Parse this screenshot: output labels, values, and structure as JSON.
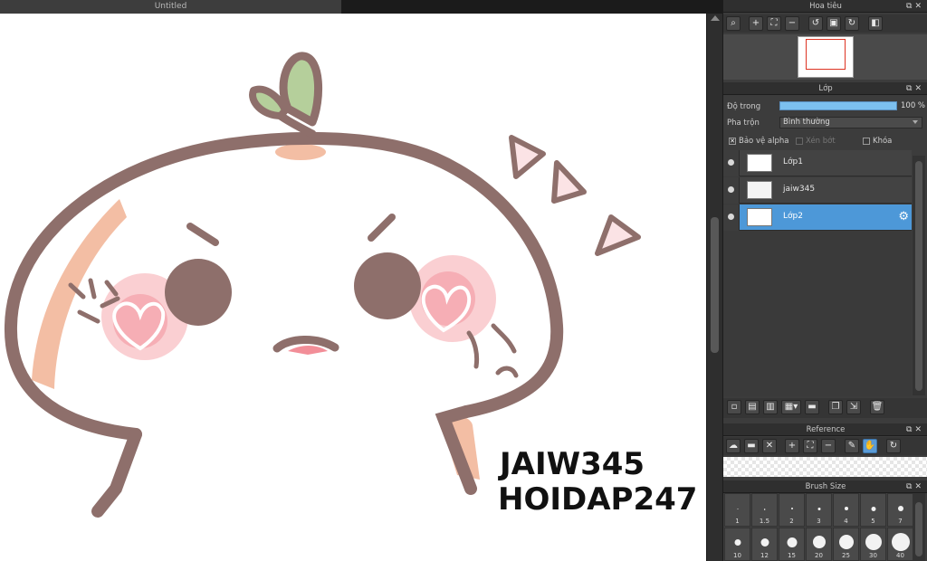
{
  "document": {
    "tab_title": "Untitled"
  },
  "canvas": {
    "watermark_line1": "JAIW345",
    "watermark_line2": "HOIDAP247"
  },
  "navigator": {
    "title": "Hoa tiêu",
    "tools": [
      "zoom-icon",
      "zoom-in-icon",
      "fit-icon",
      "zoom-out-icon",
      "rotate-left-icon",
      "actual-size-icon",
      "rotate-right-icon",
      "flip-icon"
    ]
  },
  "layers": {
    "title": "Lớp",
    "opacity_label": "Độ trong",
    "opacity_value": "100 %",
    "opacity_fraction": 1.0,
    "blend_label": "Pha trộn",
    "blend_value": "Bình thường",
    "protect_alpha": "Bảo vệ alpha",
    "protect_alpha_checked": true,
    "clipping": "Xén bớt",
    "lock": "Khóa",
    "items": [
      {
        "name": "Lớp1",
        "selected": false
      },
      {
        "name": "jaiw345",
        "selected": false
      },
      {
        "name": "Lớp2",
        "selected": true
      }
    ]
  },
  "reference": {
    "title": "Reference"
  },
  "brush_size": {
    "title": "Brush Size",
    "sizes": [
      "1",
      "1.5",
      "2",
      "3",
      "4",
      "5",
      "7",
      "10",
      "12",
      "15",
      "20",
      "25",
      "30",
      "40"
    ]
  },
  "colors": {
    "accent": "#4d98d8",
    "outline": "#8e6f6b",
    "blush": "#f5a7ad",
    "leaf": "#b5cf9b",
    "peach": "#f2b79a"
  }
}
